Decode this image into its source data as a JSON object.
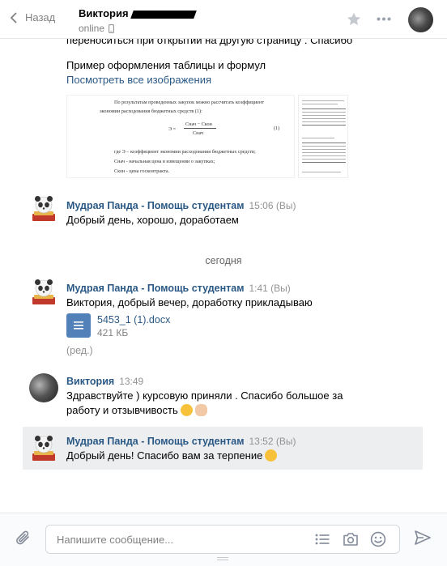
{
  "header": {
    "back_label": "Назад",
    "peer_name": "Виктория",
    "peer_status": "online"
  },
  "messages": {
    "m1_text_cut": "переноситься при открытии на другую страницу . Спасибо",
    "m1_text2": "Пример оформления таблицы и формул",
    "m1_link": "Посмотреть все изображения",
    "doc_preview": {
      "line1": "По результатам проведенных закупок можно рассчитать коэффициент",
      "line2": "экономии расходования бюджетных средств (1):",
      "formula_lhs": "Э =",
      "formula_num": "Снач − Скон",
      "formula_den": "Снач",
      "formula_no": "(1)",
      "line3": "где Э – коэффициент экономии расходования бюджетных средств;",
      "line4": "Снач - начальная цена в извещении о закупках;",
      "line5": "Скон - цена госконтракта."
    },
    "m2_author": "Мудрая Панда - Помощь студентам",
    "m2_time": "15:06 (Вы)",
    "m2_text": "Добрый день, хорошо, доработаем",
    "day_separator": "сегодня",
    "m3_author": "Мудрая Панда - Помощь студентам",
    "m3_time": "1:41 (Вы)",
    "m3_text": "Виктория, добрый вечер, доработку прикладываю",
    "m3_file_name": "5453_1 (1).docx",
    "m3_file_size": "421 КБ",
    "m3_edited": "(ред.)",
    "m4_author": "Виктория",
    "m4_time": "13:49",
    "m4_text1": "Здравствуйте ) курсовую приняли . Спасибо большое за",
    "m4_text2": "работу и отзывчивость",
    "m5_author": "Мудрая Панда - Помощь студентам",
    "m5_time": "13:52 (Вы)",
    "m5_text": "Добрый день! Спасибо вам за терпение"
  },
  "composer": {
    "placeholder": "Напишите сообщение..."
  },
  "colors": {
    "link": "#2a5885",
    "muted": "#828282",
    "highlight_bg": "#edeef0",
    "accent": "#5181b8"
  }
}
